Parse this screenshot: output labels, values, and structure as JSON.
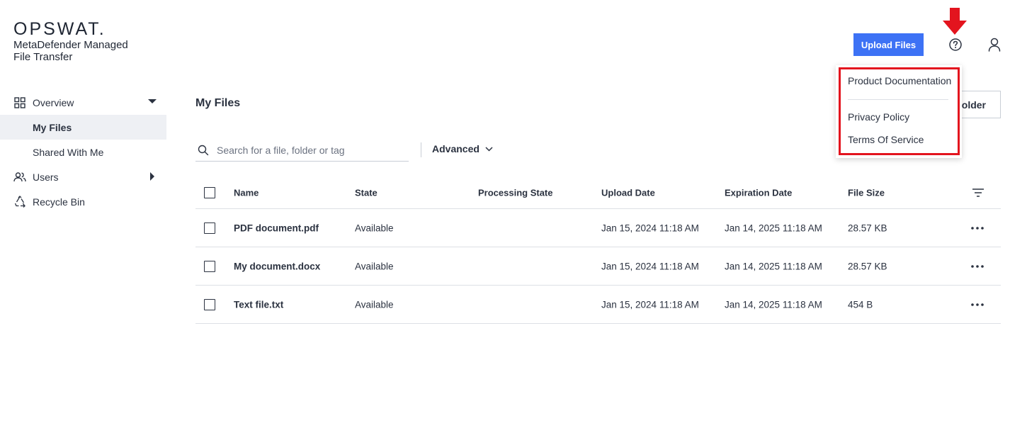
{
  "brand": {
    "logo": "OPSWAT.",
    "product_line1": "MetaDefender Managed",
    "product_line2": "File Transfer"
  },
  "header": {
    "upload_label": "Upload Files",
    "accent": "#3d72f5"
  },
  "sidebar": {
    "items": [
      {
        "label": "Overview",
        "icon": "grid-icon"
      },
      {
        "label": "My Files"
      },
      {
        "label": "Shared With Me"
      },
      {
        "label": "Users",
        "icon": "users-icon"
      },
      {
        "label": "Recycle Bin",
        "icon": "recycle-icon"
      }
    ]
  },
  "main": {
    "title": "My Files",
    "folder_btn": "Folder",
    "search_placeholder": "Search for a file, folder or tag",
    "advanced_label": "Advanced"
  },
  "table": {
    "columns": [
      "Name",
      "State",
      "Processing State",
      "Upload Date",
      "Expiration Date",
      "File Size"
    ],
    "rows": [
      {
        "name": "PDF document.pdf",
        "state": "Available",
        "processing": "",
        "upload": "Jan 15, 2024 11:18 AM",
        "expiration": "Jan 14, 2025 11:18 AM",
        "size": "28.57 KB"
      },
      {
        "name": "My document.docx",
        "state": "Available",
        "processing": "",
        "upload": "Jan 15, 2024 11:18 AM",
        "expiration": "Jan 14, 2025 11:18 AM",
        "size": "28.57 KB"
      },
      {
        "name": "Text file.txt",
        "state": "Available",
        "processing": "",
        "upload": "Jan 15, 2024 11:18 AM",
        "expiration": "Jan 14, 2025 11:18 AM",
        "size": "454 B"
      }
    ]
  },
  "help_menu": {
    "items": [
      "Product Documentation",
      "Privacy Policy",
      "Terms Of Service"
    ],
    "highlight_color": "#e3141e"
  }
}
